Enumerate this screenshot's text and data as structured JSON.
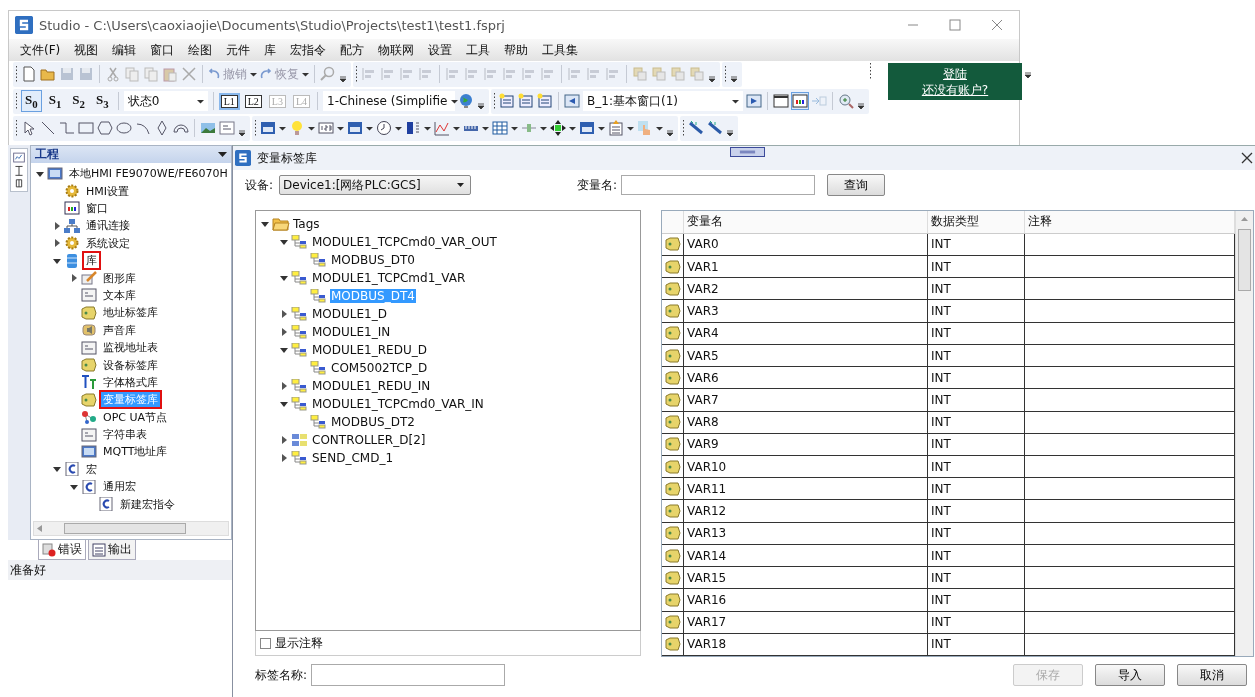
{
  "window": {
    "title": "Studio - C:\\Users\\caoxiaojie\\Documents\\Studio\\Projects\\test1\\test1.fsprj"
  },
  "menu": [
    "文件(F)",
    "视图",
    "编辑",
    "窗口",
    "绘图",
    "元件",
    "库",
    "宏指令",
    "配方",
    "物联网",
    "设置",
    "工具",
    "帮助",
    "工具集"
  ],
  "toolbar": {
    "undo": "撤销",
    "redo": "恢复",
    "states": [
      {
        "label": "S$_{0}$",
        "selected": true
      },
      {
        "label": "S$_{1}$",
        "selected": false
      },
      {
        "label": "S$_{2}$",
        "selected": false
      },
      {
        "label": "S$_{3}$",
        "selected": false
      }
    ],
    "state_select": "状态0",
    "layers": [
      {
        "label": "L1",
        "selected": true,
        "disabled": false
      },
      {
        "label": "L2",
        "selected": false,
        "disabled": false
      },
      {
        "label": "L3",
        "selected": false,
        "disabled": true
      },
      {
        "label": "L4",
        "selected": false,
        "disabled": true
      }
    ],
    "language": "1-Chinese (Simplifie",
    "window_select": "B_1:基本窗口(1)"
  },
  "account": {
    "login": "登陆",
    "signup": "还没有账户?"
  },
  "project_panel": {
    "title": "工程",
    "tree": [
      {
        "label": "本地HMI FE9070WE/FE6070H",
        "kind": "monitor",
        "expanded": true,
        "selected": false,
        "highlighted": false,
        "children": [
          {
            "label": "HMI设置",
            "kind": "gear",
            "selected": false,
            "highlighted": false
          },
          {
            "label": "窗口",
            "kind": "window",
            "selected": false,
            "highlighted": false
          },
          {
            "label": "通讯连接",
            "kind": "network",
            "expanded": false,
            "selected": false,
            "highlighted": false
          },
          {
            "label": "系统设定",
            "kind": "gear",
            "expanded": false,
            "selected": false,
            "highlighted": false
          },
          {
            "label": "库",
            "kind": "database",
            "expanded": true,
            "selected": false,
            "highlighted": true,
            "children": [
              {
                "label": "图形库",
                "kind": "brush",
                "expanded": false,
                "selected": false,
                "highlighted": false
              },
              {
                "label": "文本库",
                "kind": "document",
                "selected": false,
                "highlighted": false
              },
              {
                "label": "地址标签库",
                "kind": "tag",
                "selected": false,
                "highlighted": false
              },
              {
                "label": "声音库",
                "kind": "speaker",
                "selected": false,
                "highlighted": false
              },
              {
                "label": "监视地址表",
                "kind": "document",
                "selected": false,
                "highlighted": false
              },
              {
                "label": "设备标签库",
                "kind": "tag",
                "selected": false,
                "highlighted": false
              },
              {
                "label": "字体格式库",
                "kind": "font",
                "selected": false,
                "highlighted": false
              },
              {
                "label": "变量标签库",
                "kind": "tag",
                "selected": true,
                "highlighted": true
              },
              {
                "label": "OPC UA节点",
                "kind": "nodes",
                "selected": false,
                "highlighted": false
              },
              {
                "label": "字符串表",
                "kind": "document",
                "selected": false,
                "highlighted": false
              },
              {
                "label": "MQTT地址库",
                "kind": "monitor",
                "selected": false,
                "highlighted": false
              }
            ]
          },
          {
            "label": "宏",
            "kind": "c-file",
            "expanded": true,
            "selected": false,
            "highlighted": false,
            "children": [
              {
                "label": "通用宏",
                "kind": "c-file",
                "expanded": true,
                "selected": false,
                "highlighted": false,
                "children": [
                  {
                    "label": "新建宏指令",
                    "kind": "c-file",
                    "selected": false,
                    "highlighted": false
                  }
                ]
              }
            ]
          }
        ]
      }
    ],
    "bottom_tabs": [
      {
        "label": "错误",
        "selected": true
      },
      {
        "label": "输出",
        "selected": false
      }
    ]
  },
  "status_bar": "准备好",
  "dialog": {
    "title": "变量标签库",
    "device_label": "设备:",
    "device": "Device1:[网络PLC:GCS]",
    "name_label": "变量名:",
    "query_button": "查询",
    "tags": [
      {
        "label": "Tags",
        "kind": "folder",
        "expanded": true,
        "selected": false,
        "children": [
          {
            "label": "MODULE1_TCPCmd0_VAR_OUT",
            "kind": "struct",
            "expanded": true,
            "selected": false,
            "children": [
              {
                "label": "MODBUS_DT0",
                "kind": "struct",
                "selected": false
              }
            ]
          },
          {
            "label": "MODULE1_TCPCmd1_VAR",
            "kind": "struct",
            "expanded": true,
            "selected": false,
            "children": [
              {
                "label": "MODBUS_DT4",
                "kind": "struct",
                "selected": true
              }
            ]
          },
          {
            "label": "MODULE1_D",
            "kind": "struct",
            "expanded": false,
            "selected": false
          },
          {
            "label": "MODULE1_IN",
            "kind": "struct",
            "expanded": false,
            "selected": false
          },
          {
            "label": "MODULE1_REDU_D",
            "kind": "struct",
            "expanded": true,
            "selected": false,
            "children": [
              {
                "label": "COM5002TCP_D",
                "kind": "struct",
                "selected": false
              }
            ]
          },
          {
            "label": "MODULE1_REDU_IN",
            "kind": "struct",
            "expanded": false,
            "selected": false
          },
          {
            "label": "MODULE1_TCPCmd0_VAR_IN",
            "kind": "struct",
            "expanded": true,
            "selected": false,
            "children": [
              {
                "label": "MODBUS_DT2",
                "kind": "struct",
                "selected": false
              }
            ]
          },
          {
            "label": "CONTROLLER_D[2]",
            "kind": "array",
            "expanded": false,
            "selected": false
          },
          {
            "label": "SEND_CMD_1",
            "kind": "struct",
            "expanded": false,
            "selected": false
          }
        ]
      }
    ],
    "show_comments": {
      "label": "显示注释",
      "checked": false
    },
    "table": {
      "columns": [
        "变量名",
        "数据类型",
        "注释"
      ],
      "rows": [
        {
          "name": "VAR0",
          "type": "INT"
        },
        {
          "name": "VAR1",
          "type": "INT"
        },
        {
          "name": "VAR2",
          "type": "INT"
        },
        {
          "name": "VAR3",
          "type": "INT"
        },
        {
          "name": "VAR4",
          "type": "INT"
        },
        {
          "name": "VAR5",
          "type": "INT"
        },
        {
          "name": "VAR6",
          "type": "INT"
        },
        {
          "name": "VAR7",
          "type": "INT"
        },
        {
          "name": "VAR8",
          "type": "INT"
        },
        {
          "name": "VAR9",
          "type": "INT"
        },
        {
          "name": "VAR10",
          "type": "INT"
        },
        {
          "name": "VAR11",
          "type": "INT"
        },
        {
          "name": "VAR12",
          "type": "INT"
        },
        {
          "name": "VAR13",
          "type": "INT"
        },
        {
          "name": "VAR14",
          "type": "INT"
        },
        {
          "name": "VAR15",
          "type": "INT"
        },
        {
          "name": "VAR16",
          "type": "INT"
        },
        {
          "name": "VAR17",
          "type": "INT"
        },
        {
          "name": "VAR18",
          "type": "INT"
        }
      ]
    },
    "tag_name_label": "标签名称:",
    "buttons": [
      {
        "label": "保存",
        "disabled": true
      },
      {
        "label": "导入",
        "disabled": false
      },
      {
        "label": "取消",
        "disabled": false
      }
    ]
  }
}
